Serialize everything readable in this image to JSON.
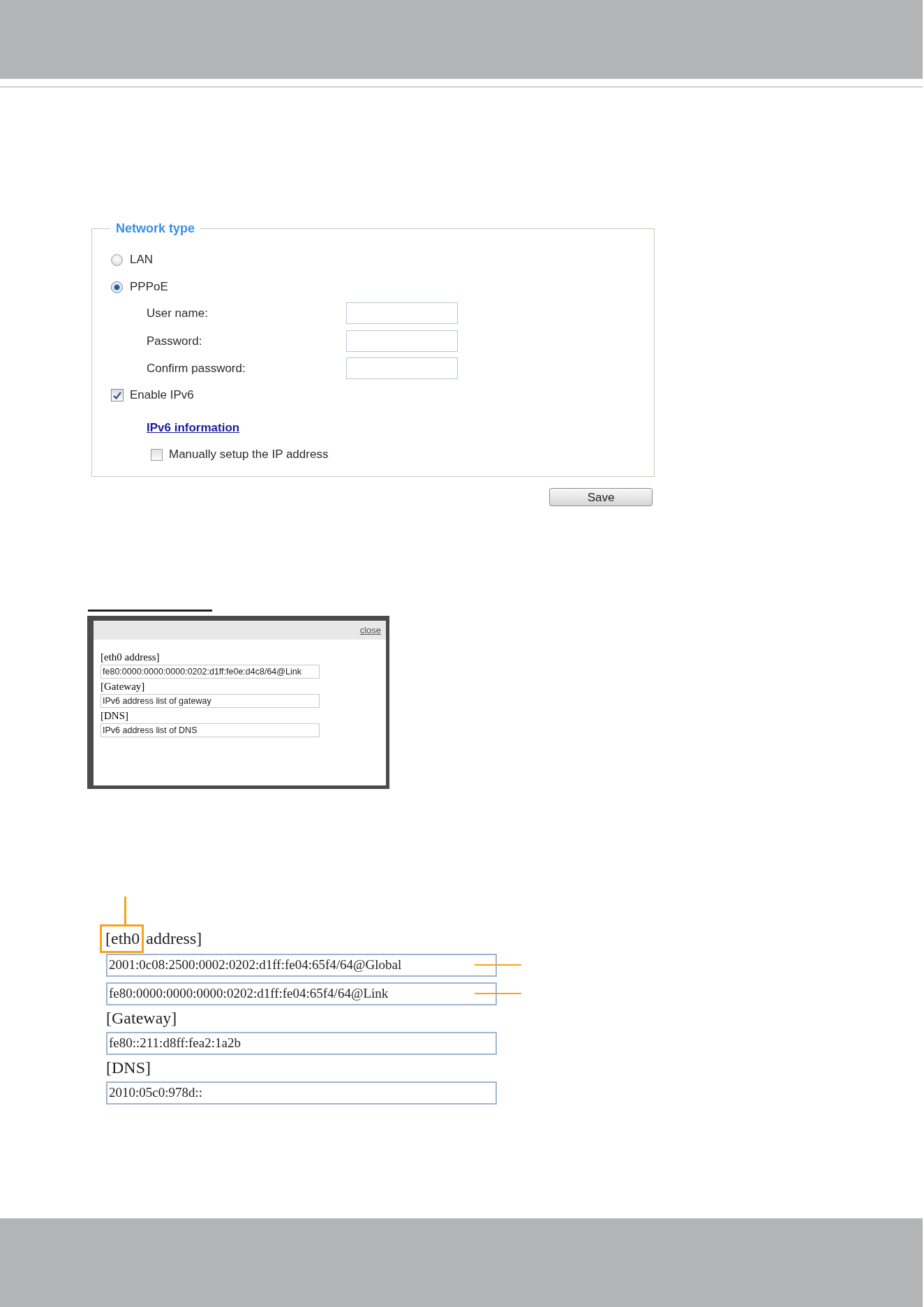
{
  "network_type": {
    "title": "Network type",
    "options": [
      {
        "label": "LAN",
        "selected": false
      },
      {
        "label": "PPPoE",
        "selected": true
      }
    ],
    "pppoe_fields": [
      {
        "label": "User name:"
      },
      {
        "label": "Password:"
      },
      {
        "label": "Confirm password:"
      }
    ],
    "enable_ipv6": {
      "label": "Enable IPv6",
      "checked": true
    },
    "ipv6_information_link": {
      "label": "IPv6 information"
    },
    "manual_ip_setup": {
      "label": "Manually setup the IP address",
      "checked": false
    }
  },
  "save_button": {
    "label": "Save"
  },
  "ipv6_information_popup": {
    "close_link": "close",
    "sections": [
      {
        "heading": "[eth0 address]",
        "values": [
          "fe80:0000:0000:0000:0202:d1ff:fe0e:d4c8/64@Link"
        ]
      },
      {
        "heading": "[Gateway]",
        "values": [
          "IPv6 address list of gateway"
        ]
      },
      {
        "heading": "[DNS]",
        "values": [
          "IPv6 address list of DNS"
        ]
      }
    ]
  },
  "ipv6_information_detail": {
    "sections": [
      {
        "heading": [
          {
            "text": "[eth0",
            "highlighted": true
          },
          {
            "text": "address]",
            "highlighted": false
          }
        ],
        "values": [
          {
            "text": "2001:0c08:2500:0002:0202:d1ff:fe04:65f4/64@Global",
            "callout": true
          },
          {
            "text": "fe80:0000:0000:0000:0202:d1ff:fe04:65f4/64@Link",
            "callout": true
          }
        ]
      },
      {
        "heading": [
          {
            "text": "[Gateway]",
            "highlighted": false
          }
        ],
        "values": [
          {
            "text": "fe80::211:d8ff:fea2:1a2b",
            "callout": false
          }
        ]
      },
      {
        "heading": [
          {
            "text": "[DNS]",
            "highlighted": false
          }
        ],
        "values": [
          {
            "text": "2010:05c0:978d::",
            "callout": false
          }
        ]
      }
    ]
  }
}
